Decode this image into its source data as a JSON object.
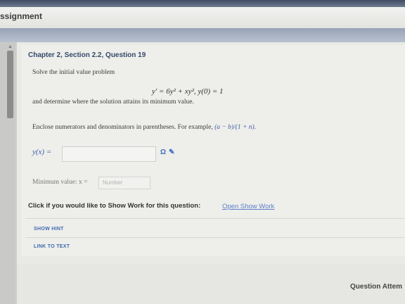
{
  "header": {
    "title": "ssignment"
  },
  "question": {
    "heading": "Chapter 2, Section 2.2, Question 19",
    "prompt": "Solve the initial value problem",
    "equation": "y′ = 6y² + xy²,  y(0) = 1",
    "followup": "and determine where the solution attains its minimum value.",
    "instruction": "Enclose numerators and denominators in parentheses. For example, ",
    "example": "(a − b)/(1 + n)."
  },
  "answer": {
    "label": "y(x) =",
    "value": ""
  },
  "minimum": {
    "label": "Minimum value: x =",
    "placeholder": "Number",
    "value": ""
  },
  "show_work": {
    "prompt": "Click if you would like to Show Work for this question:",
    "link": "Open Show Work"
  },
  "buttons": {
    "show_hint": "SHOW HINT",
    "link_to_text": "LINK TO TEXT"
  },
  "footer": {
    "attempts": "Question Attem"
  }
}
